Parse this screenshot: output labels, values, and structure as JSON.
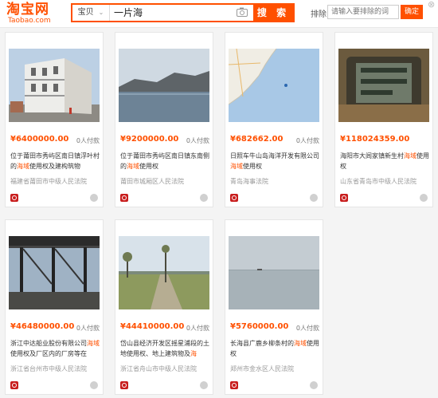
{
  "header": {
    "logo_cn": "淘宝网",
    "logo_en": "Taobao.com",
    "search_scope": "宝贝",
    "search_query": "一片海",
    "search_button": "搜 索",
    "exclude_label": "排除",
    "exclude_placeholder": "请输入要排除的词",
    "exclude_button": "确定"
  },
  "items": [
    {
      "price": "¥6400000.00",
      "bids": "0人付款",
      "title_pre": "位于莆田市秀屿区南日镇浮叶村的",
      "title_hl": "海域",
      "title_post": "使用权及建构筑物",
      "court": "福建省莆田市中级人民法院"
    },
    {
      "price": "¥9200000.00",
      "bids": "0人付款",
      "title_pre": "位于莆田市秀屿区南日镇东南侧的",
      "title_hl": "海域",
      "title_post": "使用权",
      "court": "莆田市城厢区人民法院"
    },
    {
      "price": "¥682662.00",
      "bids": "0人付款",
      "title_pre": "日照车牛山岛海洋开发有限公司",
      "title_hl": "海域",
      "title_post": "使用权",
      "court": "青岛海事法院"
    },
    {
      "price": "¥118024359.00",
      "bids": "",
      "title_pre": "海阳市大闾家镇新生村",
      "title_hl": "海域",
      "title_post": "使用权",
      "court": "山东省青岛市中级人民法院"
    },
    {
      "price": "¥46480000.00",
      "bids": "0人付款",
      "title_pre": "浙江中达船业股份有限公司",
      "title_hl": "海域",
      "title_post": "使用权及厂区内的厂房等在",
      "court": "浙江省台州市中级人民法院"
    },
    {
      "price": "¥44410000.00",
      "bids": "0人付款",
      "title_pre": "岱山县经济开发区摇星浦段的土地使用权、地上建筑物及",
      "title_hl": "海",
      "title_post": "",
      "court": "浙江省舟山市中级人民法院"
    },
    {
      "price": "¥5760000.00",
      "bids": "0人付款",
      "title_pre": "长海县广鹿乡柳条村的",
      "title_hl": "海域",
      "title_post": "使用权",
      "court": "郑州市金水区人民法院"
    }
  ]
}
